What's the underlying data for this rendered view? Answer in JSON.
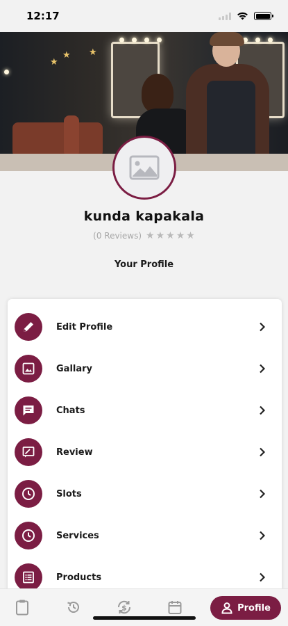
{
  "status_bar": {
    "time": "12:17"
  },
  "profile": {
    "name": "kunda kapakala",
    "reviews_text": "(0 Reviews)",
    "rating": 0,
    "max_rating": 5,
    "section_title": "Your Profile"
  },
  "menu": {
    "items": [
      {
        "label": "Edit Profile",
        "icon": "pencil-icon"
      },
      {
        "label": "Gallary",
        "icon": "image-icon"
      },
      {
        "label": "Chats",
        "icon": "chat-icon"
      },
      {
        "label": "Review",
        "icon": "review-icon"
      },
      {
        "label": "Slots",
        "icon": "clock-icon"
      },
      {
        "label": "Services",
        "icon": "clock-icon"
      },
      {
        "label": "Products",
        "icon": "list-icon"
      }
    ]
  },
  "bottom_nav": {
    "items": [
      "clipboard-icon",
      "history-icon",
      "dollar-sync-icon",
      "calendar-icon"
    ],
    "active_label": "Profile"
  },
  "colors": {
    "accent": "#7b1d43",
    "background": "#f2f2f2",
    "card": "#ffffff"
  }
}
